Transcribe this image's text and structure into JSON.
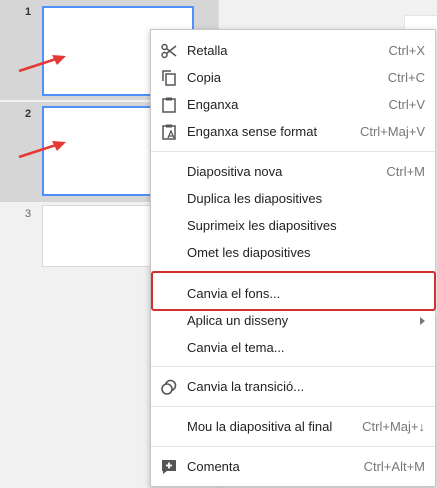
{
  "filmstrip": {
    "slides": [
      {
        "number": "1",
        "selected": true
      },
      {
        "number": "2",
        "selected": true
      },
      {
        "number": "3",
        "selected": false
      }
    ]
  },
  "context_menu": {
    "items": [
      {
        "label": "Retalla",
        "shortcut": "Ctrl+X",
        "icon": "scissors-icon"
      },
      {
        "label": "Copia",
        "shortcut": "Ctrl+C",
        "icon": "copy-icon"
      },
      {
        "label": "Enganxa",
        "shortcut": "Ctrl+V",
        "icon": "clipboard-icon"
      },
      {
        "label": "Enganxa sense format",
        "shortcut": "Ctrl+Maj+V",
        "icon": "clipboard-text-icon"
      },
      {
        "label": "Diapositiva nova",
        "shortcut": "Ctrl+M"
      },
      {
        "label": "Duplica les diapositives",
        "shortcut": ""
      },
      {
        "label": "Suprimeix les diapositives",
        "shortcut": ""
      },
      {
        "label": "Omet les diapositives",
        "shortcut": ""
      },
      {
        "label": "Canvia el fons...",
        "shortcut": ""
      },
      {
        "label": "Aplica un disseny",
        "shortcut": "",
        "submenu": true
      },
      {
        "label": "Canvia el tema...",
        "shortcut": ""
      },
      {
        "label": "Canvia la transició...",
        "shortcut": "",
        "icon": "transition-icon"
      },
      {
        "label": "Mou la diapositiva al final",
        "shortcut": "Ctrl+Maj+↓"
      },
      {
        "label": "Comenta",
        "shortcut": "Ctrl+Alt+M",
        "icon": "add-comment-icon"
      }
    ]
  },
  "annotations": {
    "arrow_color": "#e53935",
    "highlight_color": "#d32f2f",
    "highlighted_item": "Canvia el fons..."
  },
  "colors": {
    "selection_border": "#4d90fe",
    "selected_row_bg": "#d6d6d6"
  }
}
